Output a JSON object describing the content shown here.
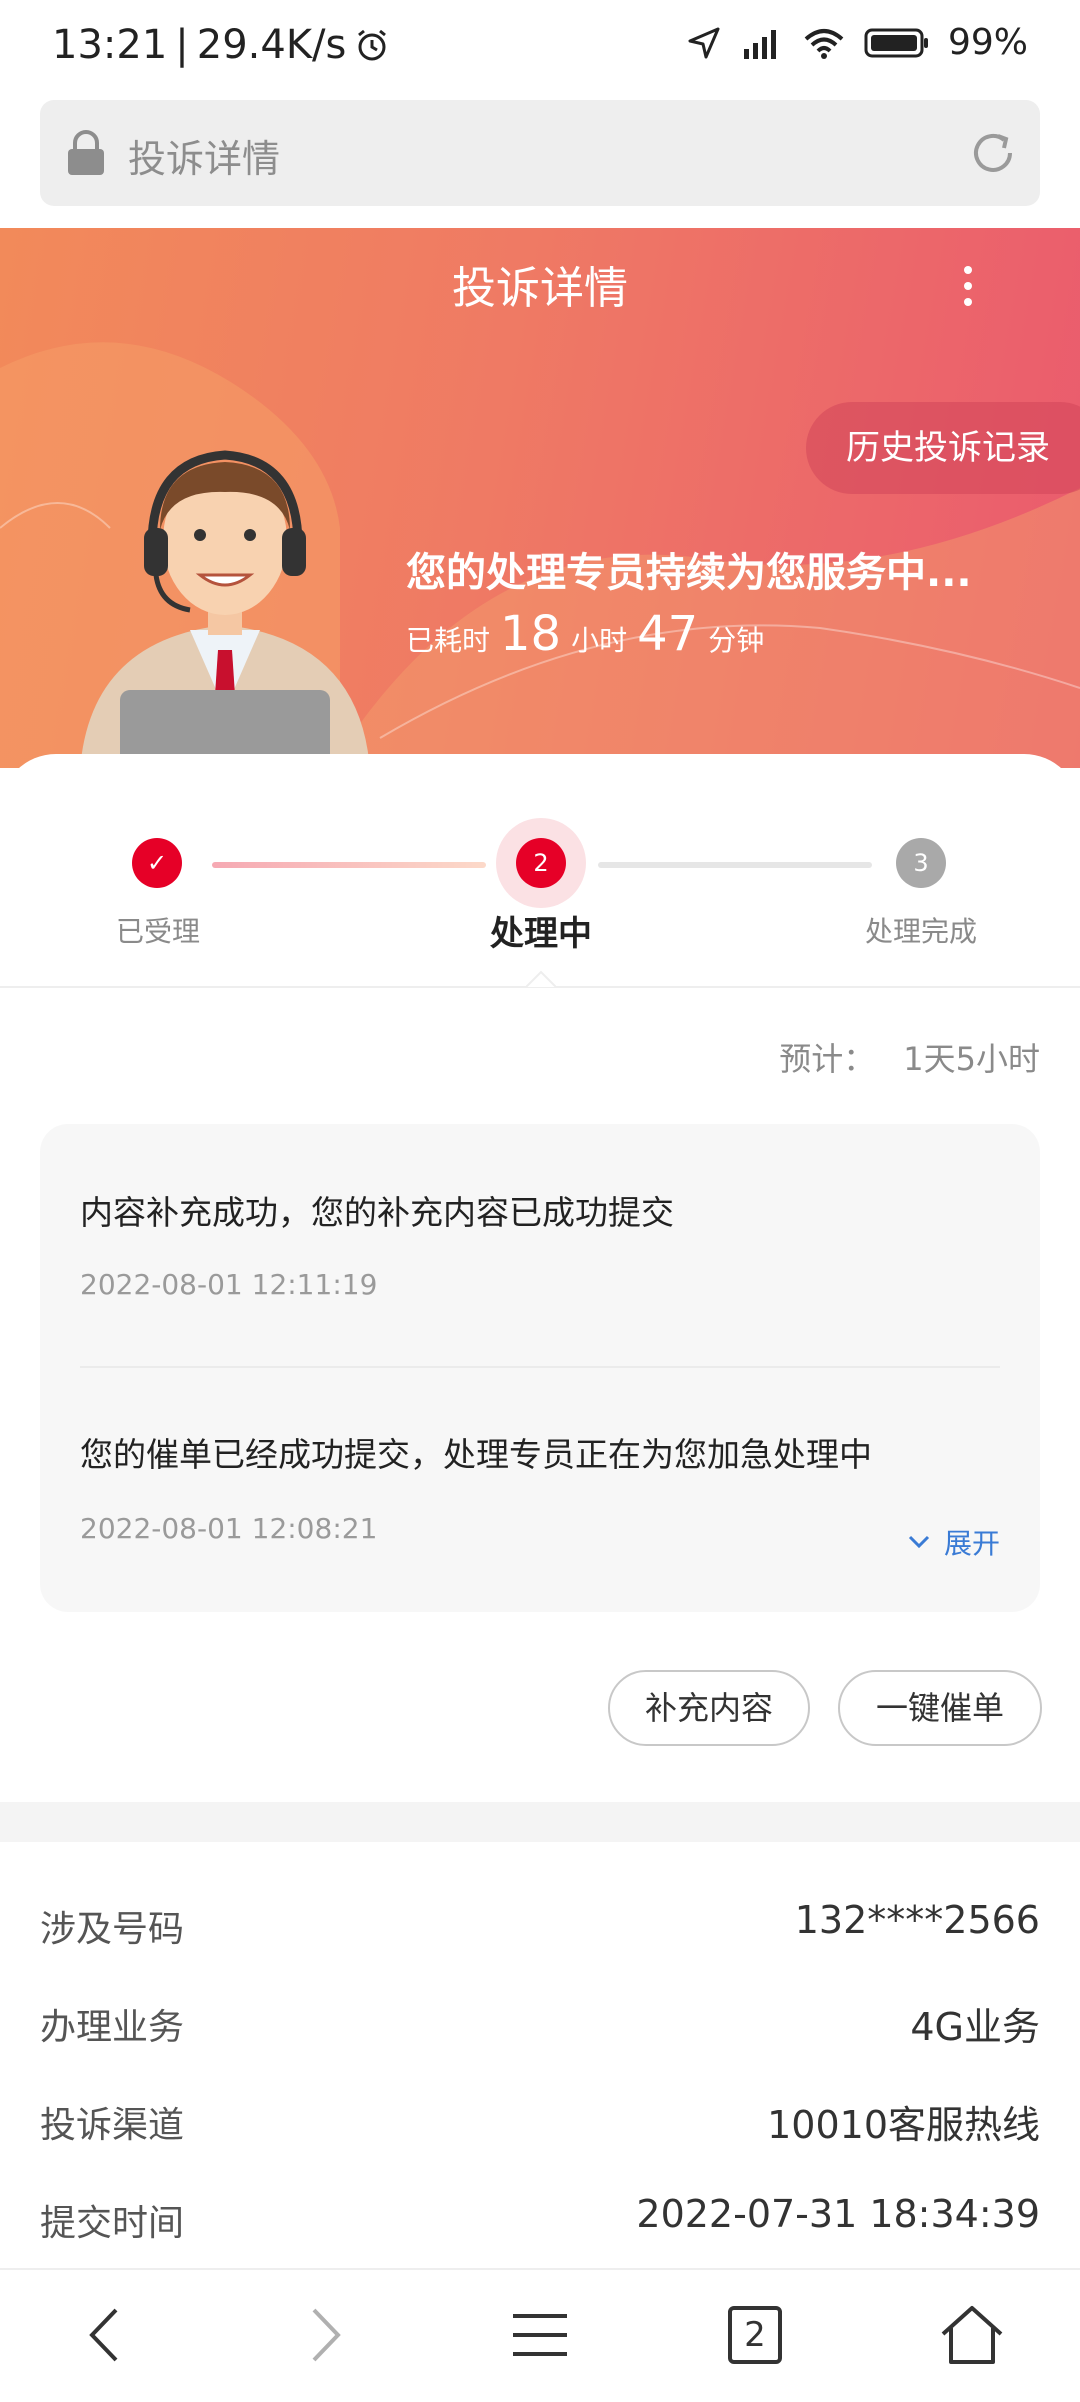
{
  "status_bar": {
    "time": "13:21",
    "speed": "29.4K/s",
    "battery": "99%"
  },
  "address_bar": {
    "text": "投诉详情"
  },
  "header": {
    "title": "投诉详情",
    "history_button": "历史投诉记录",
    "service_message": "您的处理专员持续为您服务中...",
    "elapsed": {
      "prefix": "已耗时",
      "hours": "18",
      "hours_unit": "小时",
      "minutes": "47",
      "minutes_unit": "分钟"
    }
  },
  "steps": [
    {
      "label": "已受理",
      "marker": "✓",
      "state": "done"
    },
    {
      "label": "处理中",
      "marker": "2",
      "state": "current"
    },
    {
      "label": "处理完成",
      "marker": "3",
      "state": "pending"
    }
  ],
  "estimate": {
    "label": "预计：",
    "value": "1天5小时"
  },
  "timeline": [
    {
      "text": "内容补充成功，您的补充内容已成功提交",
      "time": "2022-08-01 12:11:19"
    },
    {
      "text": "您的催单已经成功提交，处理专员正在为您加急处理中",
      "time": "2022-08-01 12:08:21"
    }
  ],
  "expand_label": "展开",
  "actions": {
    "supplement": "补充内容",
    "urge": "一键催单"
  },
  "info": [
    {
      "label": "涉及号码",
      "value": "132****2566"
    },
    {
      "label": "办理业务",
      "value": "4G业务"
    },
    {
      "label": "投诉渠道",
      "value": "10010客服热线"
    },
    {
      "label": "提交时间",
      "value": "2022-07-31 18:34:39"
    }
  ],
  "bottom_nav": {
    "tab_count": "2"
  },
  "colors": {
    "accent": "#e60027",
    "link": "#3a7bd5",
    "header_start": "#f28a5a",
    "header_end": "#ea5a6e"
  }
}
